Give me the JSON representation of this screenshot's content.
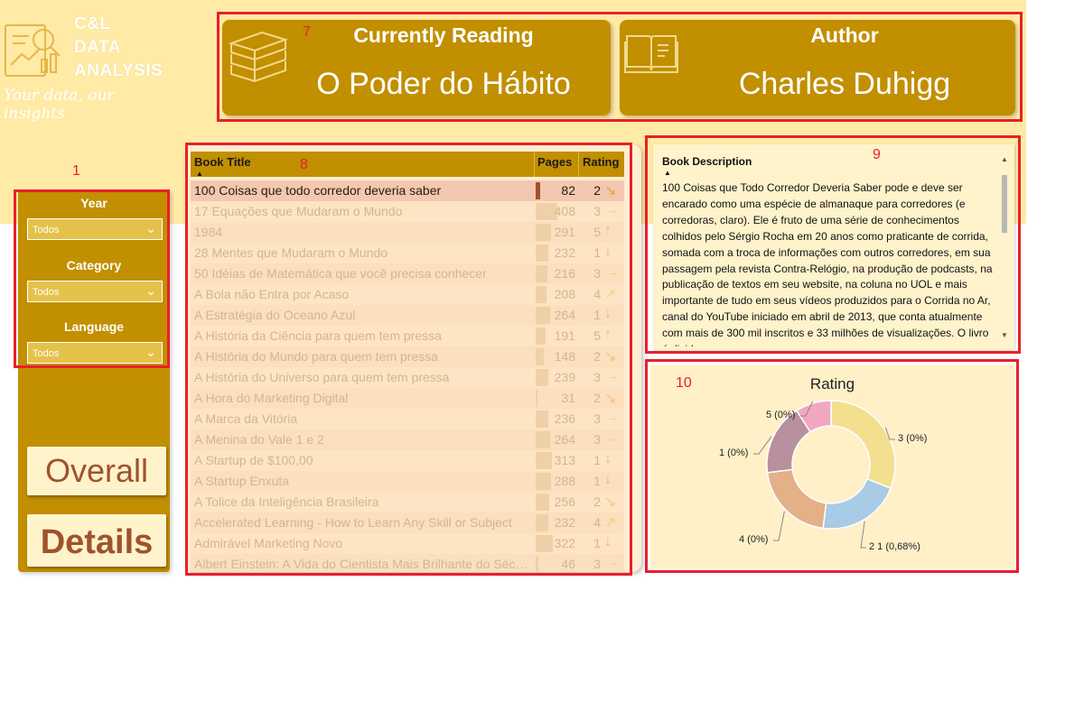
{
  "logo": {
    "line1": "C&L",
    "line2": "DATA",
    "line3": "ANALYSIS",
    "tagline": "Your data, our insights"
  },
  "annotations": {
    "filters": "1",
    "header_cards": "7",
    "book_table": "8",
    "description": "9",
    "rating_chart": "10"
  },
  "cards": {
    "reading_title": "Currently Reading",
    "reading_value": "O Poder do Hábito",
    "author_title": "Author",
    "author_value": "Charles Duhigg",
    "reading_icon": "books-stack-icon",
    "author_icon": "open-book-icon"
  },
  "filters": [
    {
      "label": "Year",
      "value": "Todos"
    },
    {
      "label": "Category",
      "value": "Todos"
    },
    {
      "label": "Language",
      "value": "Todos"
    }
  ],
  "nav": {
    "overall": "Overall",
    "details": "Details"
  },
  "table": {
    "columns": [
      "Book Title",
      "Pages",
      "Rating"
    ],
    "rows": [
      {
        "title": "100 Coisas que todo corredor deveria saber",
        "pages": 82,
        "rating": 2,
        "arrow": "↘",
        "selected": true
      },
      {
        "title": "17 Equações que Mudaram o Mundo",
        "pages": 408,
        "rating": 3,
        "arrow": "→"
      },
      {
        "title": "1984",
        "pages": 291,
        "rating": 5,
        "arrow": "↑"
      },
      {
        "title": "28 Mentes que Mudaram o Mundo",
        "pages": 232,
        "rating": 1,
        "arrow": "↓"
      },
      {
        "title": "50 Idéias de Matemática que você precisa conhecer",
        "pages": 216,
        "rating": 3,
        "arrow": "→"
      },
      {
        "title": "A Bola não Entra por Acaso",
        "pages": 208,
        "rating": 4,
        "arrow": "↗"
      },
      {
        "title": "A Estratégia do Oceano Azul",
        "pages": 264,
        "rating": 1,
        "arrow": "↓"
      },
      {
        "title": "A História da Ciência para quem tem pressa",
        "pages": 191,
        "rating": 5,
        "arrow": "↑"
      },
      {
        "title": "A História do Mundo para quem tem pressa",
        "pages": 148,
        "rating": 2,
        "arrow": "↘"
      },
      {
        "title": "A História do Universo para quem tem pressa",
        "pages": 239,
        "rating": 3,
        "arrow": "→"
      },
      {
        "title": "A Hora do Marketing Digital",
        "pages": 31,
        "rating": 2,
        "arrow": "↘"
      },
      {
        "title": "A Marca da Vitória",
        "pages": 236,
        "rating": 3,
        "arrow": "→"
      },
      {
        "title": "A Menina do Vale 1 e 2",
        "pages": 264,
        "rating": 3,
        "arrow": "→"
      },
      {
        "title": "A Startup de $100,00",
        "pages": 313,
        "rating": 1,
        "arrow": "↓"
      },
      {
        "title": "A Startup Enxuta",
        "pages": 288,
        "rating": 1,
        "arrow": "↓"
      },
      {
        "title": "A Tolice da Inteligência Brasileira",
        "pages": 256,
        "rating": 2,
        "arrow": "↘"
      },
      {
        "title": "Accelerated Learning - How to Learn Any Skill or Subject",
        "pages": 232,
        "rating": 4,
        "arrow": "↗"
      },
      {
        "title": "Admirável Marketing Novo",
        "pages": 322,
        "rating": 1,
        "arrow": "↓"
      },
      {
        "title": "Albert Einstein: A Vida do Cientista Mais Brilhante do Século",
        "pages": 46,
        "rating": 3,
        "arrow": "→"
      }
    ]
  },
  "description": {
    "heading": "Book Description",
    "text": "100 Coisas que Todo Corredor Deveria Saber pode e deve ser encarado como uma espécie de almanaque para corredores (e corredoras, claro). Ele é fruto de uma série de conhecimentos colhidos pelo Sérgio Rocha em 20 anos como praticante de corrida, somada com a troca de informações com outros corredores, em sua passagem pela revista Contra-Relógio, na produção de podcasts, na publicação de textos em seu website, na coluna no UOL e mais importante de tudo em seus vídeos produzidos para o Corrida no Ar, canal do YouTube iniciado em abril de 2013, que conta atualmente com mais de 300 mil inscritos e 33 milhões de visualizações. O livro é divido"
  },
  "colors": {
    "gold": "#c18f00",
    "cream": "#ffeaa6",
    "annotation_red": "#e8202a",
    "rating_1": "#b8909e",
    "rating_2": "#a8cbe6",
    "rating_3": "#f4df8e",
    "rating_4": "#e3b088",
    "rating_5": "#f0a8c0"
  },
  "chart_data": {
    "type": "pie",
    "title": "Rating",
    "donut": true,
    "categories": [
      "3",
      "2",
      "4",
      "1",
      "5"
    ],
    "values": [
      0.0,
      0.68,
      0.0,
      0.0,
      0.0
    ],
    "display_share": [
      31,
      21,
      21,
      18,
      9
    ],
    "labels": [
      "3 (0%)",
      "2 1 (0,68%)",
      "4 (0%)",
      "1 (0%)",
      "5 (0%)"
    ],
    "colors": [
      "#f4df8e",
      "#a8cbe6",
      "#e3b088",
      "#b8909e",
      "#f0a8c0"
    ]
  }
}
